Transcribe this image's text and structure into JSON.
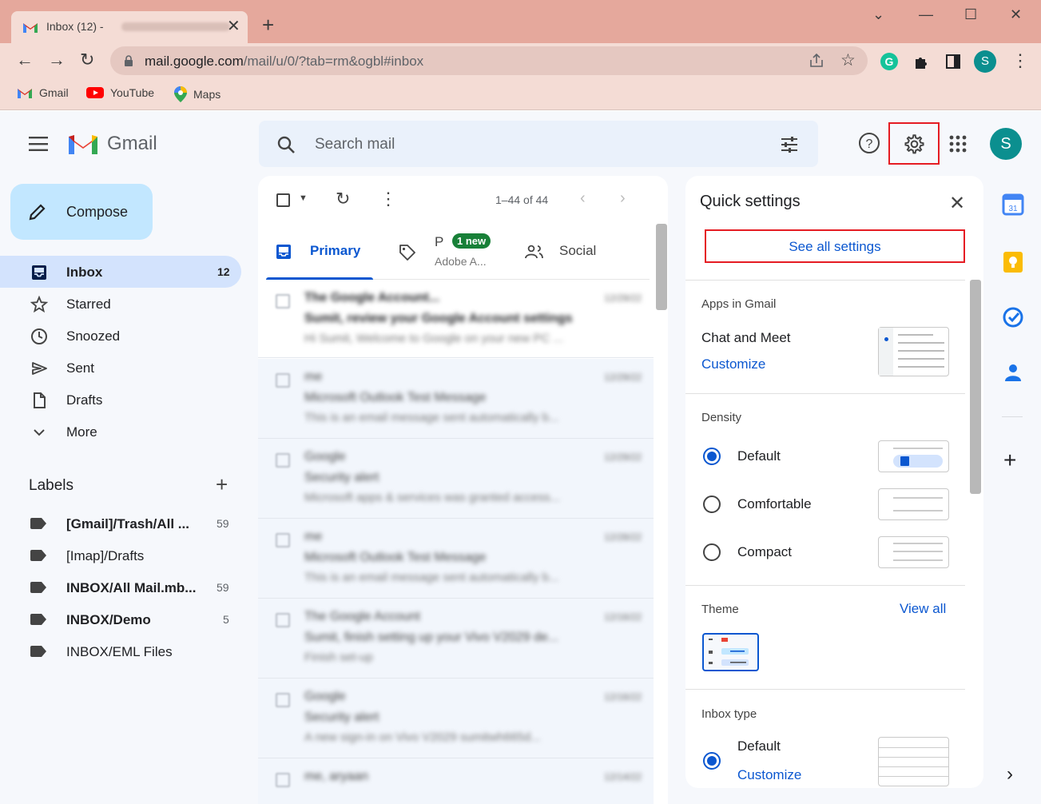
{
  "browser": {
    "tab_title": "Inbox (12) -",
    "new_tab": "+",
    "url_host": "mail.google.com",
    "url_path": "/mail/u/0/?tab=rm&ogbl#inbox",
    "profile_initial": "S",
    "bookmarks": [
      "Gmail",
      "YouTube",
      "Maps"
    ]
  },
  "gmail": {
    "logo_text": "Gmail",
    "search_placeholder": "Search mail",
    "avatar_initial": "S",
    "compose_label": "Compose",
    "nav": [
      {
        "label": "Inbox",
        "count": "12"
      },
      {
        "label": "Starred",
        "count": ""
      },
      {
        "label": "Snoozed",
        "count": ""
      },
      {
        "label": "Sent",
        "count": ""
      },
      {
        "label": "Drafts",
        "count": ""
      },
      {
        "label": "More",
        "count": ""
      }
    ],
    "labels_title": "Labels",
    "labels": [
      {
        "label": "[Gmail]/Trash/All ...",
        "count": "59"
      },
      {
        "label": "[Imap]/Drafts",
        "count": ""
      },
      {
        "label": "INBOX/All Mail.mb...",
        "count": "59"
      },
      {
        "label": "INBOX/Demo",
        "count": "5"
      },
      {
        "label": "INBOX/EML Files",
        "count": ""
      }
    ],
    "pagination": "1–44 of 44",
    "tabs": {
      "primary": "Primary",
      "promotions_initial": "P",
      "promotions_badge": "1 new",
      "promotions_sub": "Adobe A...",
      "social": "Social"
    },
    "emails": [
      {
        "sender": "The Google Account...",
        "subject": "Sumit, review your Google Account settings",
        "snippet": "Hi Sumit, Welcome to Google on your new PC ...",
        "date": "12/29/22"
      },
      {
        "sender": "me",
        "subject": "Microsoft Outlook Test Message",
        "snippet": "This is an email message sent automatically b...",
        "date": "12/29/22"
      },
      {
        "sender": "Google",
        "subject": "Security alert",
        "snippet": "Microsoft apps & services was granted access...",
        "date": "12/29/22"
      },
      {
        "sender": "me",
        "subject": "Microsoft Outlook Test Message",
        "snippet": "This is an email message sent automatically b...",
        "date": "12/28/22"
      },
      {
        "sender": "The Google Account",
        "subject": "Sumit, finish setting up your Vivo V2029 de...",
        "snippet": "Finish set-up",
        "date": "12/16/22"
      },
      {
        "sender": "Google",
        "subject": "Security alert",
        "snippet": "A new sign-in on Vivo V2029 sumitwh665d...",
        "date": "12/16/22"
      },
      {
        "sender": "me, aryaan",
        "subject": "",
        "snippet": "",
        "date": "12/14/22"
      }
    ]
  },
  "quick_settings": {
    "title": "Quick settings",
    "see_all": "See all settings",
    "apps_heading": "Apps in Gmail",
    "chat_meet": "Chat and Meet",
    "customize": "Customize",
    "density_heading": "Density",
    "density_options": [
      "Default",
      "Comfortable",
      "Compact"
    ],
    "density_selected": "Default",
    "theme_heading": "Theme",
    "view_all": "View all",
    "inbox_type_heading": "Inbox type",
    "inbox_default": "Default",
    "inbox_customize": "Customize"
  },
  "colors": {
    "accent": "#0b57d0",
    "highlight_red": "#e51c23",
    "tab_strip": "#e5a89c",
    "avatar": "#0b8f8f"
  }
}
